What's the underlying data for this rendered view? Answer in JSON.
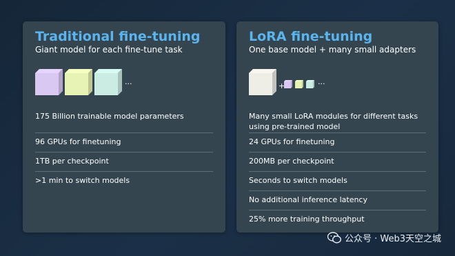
{
  "left_card": {
    "title": "Traditional fine-tuning",
    "subtitle": "Giant model for each fine-tune task",
    "ellipsis": "...",
    "cube_colors": [
      "#d9c8f2",
      "#e7f2b5",
      "#cbece3"
    ],
    "points": [
      "175 Billion trainable model parameters",
      "96 GPUs for finetuning",
      "1TB per checkpoint",
      ">1 min to switch models"
    ]
  },
  "right_card": {
    "title": "LoRA fine-tuning",
    "subtitle": "One base model + many small adapters",
    "plus": "+",
    "ellipsis": "...",
    "base_color": "#eeede6",
    "adapter_colors": [
      "#d9c8f2",
      "#e7f2b5",
      "#cbece3"
    ],
    "points": [
      "Many small LoRA modules for different tasks using pre-trained model",
      "24 GPUs for finetuning",
      "200MB per checkpoint",
      "Seconds to switch models",
      "No additional inference latency",
      "25% more training throughput"
    ]
  },
  "watermark": {
    "text": "公众号 · Web3天空之城",
    "icon": "wechat-icon"
  }
}
